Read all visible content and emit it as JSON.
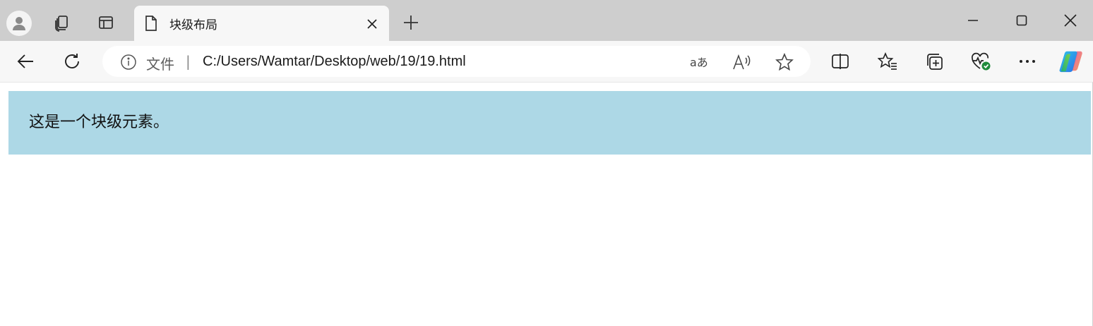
{
  "browser": {
    "tab": {
      "title": "块级布局"
    },
    "address": {
      "scheme_label": "文件",
      "separator": "|",
      "url": "C:/Users/Wamtar/Desktop/web/19/19.html"
    },
    "icons": {
      "profile": "profile-avatar-icon",
      "workspaces": "workspaces-icon",
      "tab_actions": "tab-actions-icon",
      "page": "page-icon",
      "close": "close-icon",
      "new_tab": "plus-icon",
      "minimize": "minimize-icon",
      "maximize": "maximize-icon",
      "window_close": "window-close-icon",
      "back": "back-arrow-icon",
      "refresh": "refresh-icon",
      "info": "info-icon",
      "translate": "translate-icon",
      "read_aloud": "read-aloud-icon",
      "favorite": "star-icon",
      "split_screen": "split-screen-icon",
      "favorites": "favorites-icon",
      "collections": "collections-icon",
      "performance": "browser-essentials-icon",
      "more": "more-icon",
      "copilot": "copilot-icon"
    },
    "colors": {
      "chrome_bg": "#cecece",
      "toolbar_bg": "#f7f7f7",
      "accent_green": "#1f8a3b"
    }
  },
  "page": {
    "block_text": "这是一个块级元素。",
    "block_bg": "#add8e6"
  }
}
